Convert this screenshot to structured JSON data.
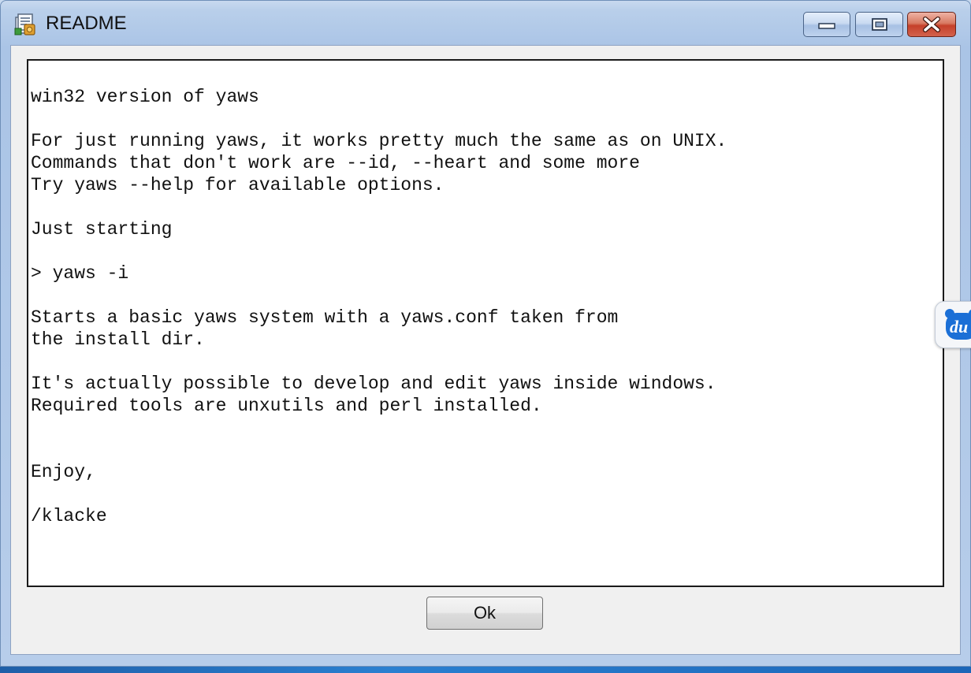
{
  "window": {
    "title": "README",
    "icon": "app-icon",
    "controls": {
      "minimize_icon": "minimize-icon",
      "maximize_icon": "maximize-icon",
      "close_icon": "close-icon"
    }
  },
  "readme": {
    "text": "win32 version of yaws\n\nFor just running yaws, it works pretty much the same as on UNIX.\nCommands that don't work are --id, --heart and some more\nTry yaws --help for available options.\n\nJust starting\n\n> yaws -i\n\nStarts a basic yaws system with a yaws.conf taken from\nthe install dir.\n\nIt's actually possible to develop and edit yaws inside windows.\nRequired tools are unxutils and perl installed.\n\n\nEnjoy,\n\n/klacke"
  },
  "buttons": {
    "ok_label": "Ok"
  },
  "side_widget": {
    "label": "du"
  },
  "colors": {
    "close_button": "#c5402a",
    "side_widget_badge": "#1b6fd6"
  }
}
